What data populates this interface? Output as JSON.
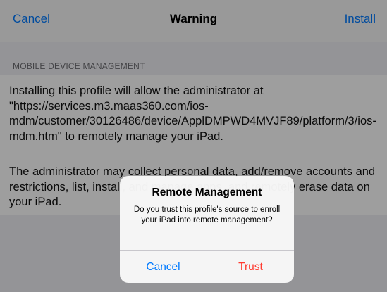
{
  "navbar": {
    "cancel_label": "Cancel",
    "title": "Warning",
    "install_label": "Install"
  },
  "section": {
    "header": "MOBILE DEVICE MANAGEMENT"
  },
  "content": {
    "paragraph1": "Installing this profile will allow the administrator at \"https://services.m3.maas360.com/ios-mdm/customer/30126486/device/ApplDMPWD4MVJF89/platform/3/ios-mdm.htm\" to remotely manage your iPad.",
    "paragraph2": "The administrator may collect personal data, add/remove accounts and restrictions, list, install, and manage apps, and remotely erase data on your iPad."
  },
  "alert": {
    "title": "Remote Management",
    "message": "Do you trust this profile's source to enroll your iPad into remote management?",
    "cancel_label": "Cancel",
    "trust_label": "Trust"
  },
  "colors": {
    "accent": "#007aff",
    "destructive": "#ff3b30",
    "background": "#efeff4"
  }
}
